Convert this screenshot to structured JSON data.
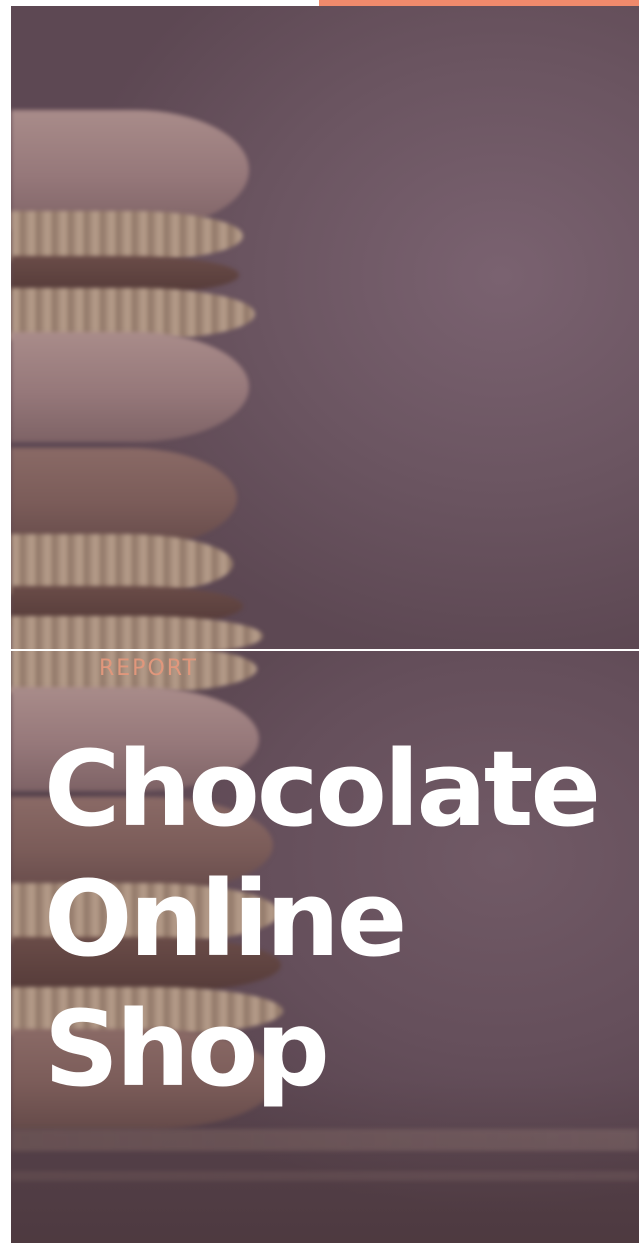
{
  "cover": {
    "tag": "REPORT",
    "title_lines": [
      "Chocolate",
      "Online",
      "Shop"
    ]
  },
  "colors": {
    "accent": "#f08a6c",
    "tag": "#e0977c",
    "title": "#ffffff",
    "overlay": "#6b5561"
  }
}
